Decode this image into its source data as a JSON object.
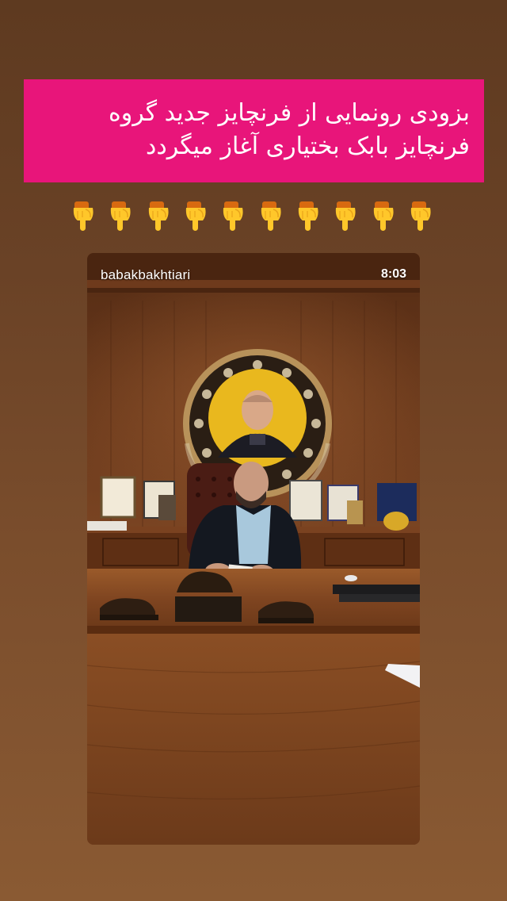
{
  "caption": {
    "line1": "بزودی رونمایی از فرنچایز جدید گروه",
    "line2": "فرنچایز بابک بختیاری  آغاز میگردد",
    "background_color": "#e8157a"
  },
  "emoji_row": {
    "icon": "backhand-index-pointing-down-icon",
    "count": 10
  },
  "video": {
    "username": "babakbakhtiari",
    "time": "8:03"
  }
}
